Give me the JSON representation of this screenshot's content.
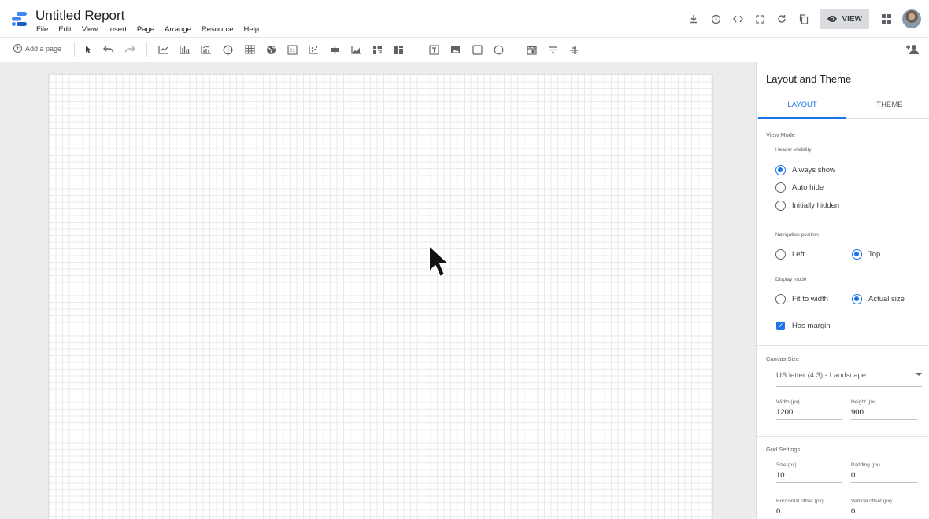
{
  "app": {
    "title": "Untitled Report",
    "menu": [
      "File",
      "Edit",
      "View",
      "Insert",
      "Page",
      "Arrange",
      "Resource",
      "Help"
    ]
  },
  "header_actions": {
    "view_label": "VIEW",
    "icons": [
      "download-icon",
      "history-icon",
      "embed-code-icon",
      "fullscreen-icon",
      "refresh-icon",
      "copy-icon",
      "apps-grid-icon",
      "avatar"
    ]
  },
  "toolbar": {
    "add_page_label": "Add a page"
  },
  "panel": {
    "title": "Layout and Theme",
    "tabs": [
      "LAYOUT",
      "THEME"
    ],
    "active_tab": "LAYOUT",
    "view_mode": {
      "section_label": "View Mode",
      "header_visibility_label": "Header visibility",
      "header_options": [
        "Always show",
        "Auto hide",
        "Initially hidden"
      ],
      "header_selected": "Always show",
      "navigation_label": "Navigation position",
      "navigation_options": [
        "Left",
        "Top"
      ],
      "navigation_selected": "Top",
      "display_mode_label": "Display mode",
      "display_options": [
        "Fit to width",
        "Actual size"
      ],
      "display_selected": "Actual size",
      "has_margin_label": "Has margin",
      "has_margin": true
    },
    "canvas_size": {
      "section_label": "Canvas Size",
      "preset": "US letter (4:3) - Landscape",
      "width_label": "Width (px)",
      "width_value": "1200",
      "height_label": "Height (px)",
      "height_value": "900"
    },
    "grid_settings": {
      "section_label": "Grid Settings",
      "size_label": "Size (px)",
      "size_value": "10",
      "padding_label": "Padding (px)",
      "padding_value": "0",
      "h_offset_label": "Horizontal offset (px)",
      "h_offset_value": "0",
      "v_offset_label": "Vertical offset (px)",
      "v_offset_value": "0"
    }
  },
  "colors": {
    "accent": "#1a73e8",
    "workspace_bg": "#ececec",
    "view_button_bg": "#dadce0"
  }
}
